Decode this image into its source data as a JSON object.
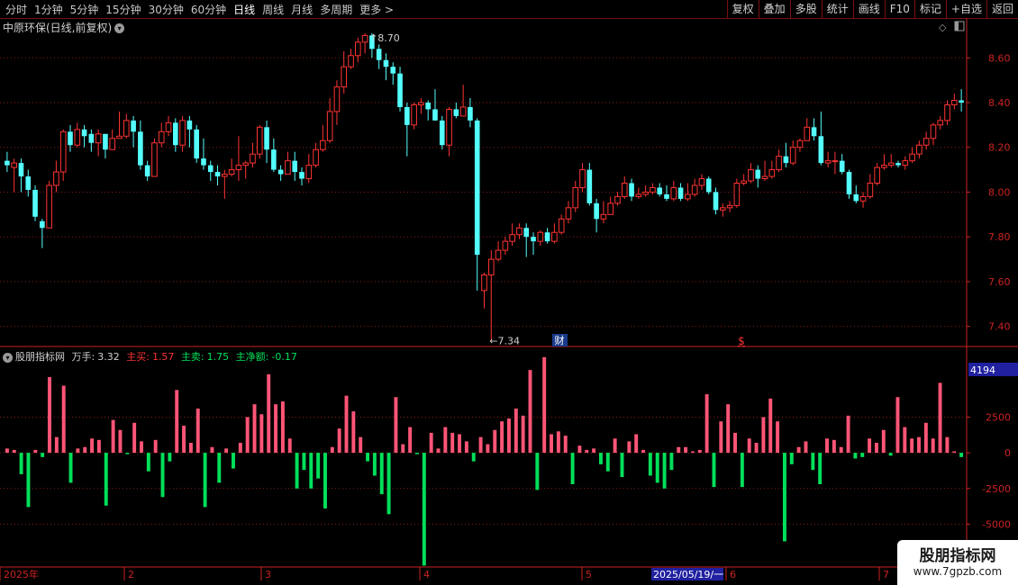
{
  "toolbar": {
    "periods": [
      "分时",
      "1分钟",
      "5分钟",
      "15分钟",
      "30分钟",
      "60分钟",
      "日线",
      "周线",
      "月线",
      "多周期",
      "更多 >"
    ],
    "active_period": "日线",
    "right_buttons": [
      "复权",
      "叠加",
      "多股",
      "统计",
      "画线",
      "F10",
      "标记",
      "+自选",
      "返回"
    ]
  },
  "main_panel": {
    "title": "中原环保(日线,前复权)",
    "high_label": "8.70",
    "low_label": "7.34",
    "marker_cai": "财",
    "marker_dollar": "$",
    "y_ticks": [
      "8.60",
      "8.40",
      "8.20",
      "8.00",
      "7.80",
      "7.60",
      "7.40"
    ]
  },
  "sub_panel": {
    "name": "股朋指标网",
    "wan_label": "万手:",
    "wan_value": "3.32",
    "buy_label": "主买:",
    "buy_value": "1.57",
    "sell_label": "主卖:",
    "sell_value": "1.75",
    "net_label": "主净额:",
    "net_value": "-0.17",
    "y_ticks": [
      "2500",
      "0",
      "-2500",
      "-5000"
    ],
    "current_value": "4194"
  },
  "x_axis": {
    "labels": [
      "2025年",
      "2",
      "3",
      "4",
      "5",
      "6",
      "7"
    ],
    "cursor_date": "2025/05/19/一"
  },
  "watermark": {
    "line1": "股朋指标网",
    "line2": "www.7gpzb.com"
  },
  "colors": {
    "up": "#ff3333",
    "down": "#54ffff",
    "vol_up": "#ff5577",
    "vol_down": "#00e05a",
    "grid": "#8b1a1a",
    "axis": "#cc2222"
  },
  "chart_data": {
    "type": "candlestick",
    "candles": [
      [
        8.14,
        8.12,
        8.18,
        8.09
      ],
      [
        8.11,
        8.13,
        8.15,
        8.0
      ],
      [
        8.13,
        8.07,
        8.15,
        8.0
      ],
      [
        8.07,
        8.01,
        8.1,
        7.98
      ],
      [
        8.01,
        7.89,
        8.03,
        7.87
      ],
      [
        7.87,
        7.84,
        7.88,
        7.75
      ],
      [
        7.84,
        8.03,
        8.05,
        7.84
      ],
      [
        8.03,
        8.09,
        8.14,
        8.0
      ],
      [
        8.09,
        8.27,
        8.28,
        8.05
      ],
      [
        8.27,
        8.21,
        8.3,
        8.18
      ],
      [
        8.21,
        8.28,
        8.31,
        8.2
      ],
      [
        8.28,
        8.25,
        8.3,
        8.2
      ],
      [
        8.26,
        8.22,
        8.28,
        8.18
      ],
      [
        8.22,
        8.26,
        8.28,
        8.16
      ],
      [
        8.26,
        8.19,
        8.26,
        8.15
      ],
      [
        8.19,
        8.24,
        8.28,
        8.2
      ],
      [
        8.24,
        8.25,
        8.36,
        8.24
      ],
      [
        8.25,
        8.32,
        8.35,
        8.24
      ],
      [
        8.32,
        8.27,
        8.34,
        8.2
      ],
      [
        8.27,
        8.12,
        8.32,
        8.1
      ],
      [
        8.12,
        8.07,
        8.14,
        8.05
      ],
      [
        8.07,
        8.22,
        8.24,
        8.07
      ],
      [
        8.22,
        8.27,
        8.31,
        8.2
      ],
      [
        8.27,
        8.31,
        8.34,
        8.25
      ],
      [
        8.31,
        8.21,
        8.33,
        8.18
      ],
      [
        8.21,
        8.32,
        8.34,
        8.18
      ],
      [
        8.32,
        8.28,
        8.34,
        8.2
      ],
      [
        8.28,
        8.15,
        8.3,
        8.13
      ],
      [
        8.15,
        8.12,
        8.24,
        8.1
      ],
      [
        8.12,
        8.09,
        8.14,
        8.05
      ],
      [
        8.09,
        8.07,
        8.12,
        8.03
      ],
      [
        8.07,
        8.08,
        8.1,
        7.97
      ],
      [
        8.08,
        8.1,
        8.15,
        8.07
      ],
      [
        8.1,
        8.12,
        8.25,
        8.05
      ],
      [
        8.12,
        8.13,
        8.14,
        8.06
      ],
      [
        8.13,
        8.17,
        8.22,
        8.11
      ],
      [
        8.17,
        8.29,
        8.3,
        8.15
      ],
      [
        8.29,
        8.19,
        8.32,
        8.13
      ],
      [
        8.19,
        8.1,
        8.24,
        8.09
      ],
      [
        8.1,
        8.08,
        8.12,
        8.05
      ],
      [
        8.08,
        8.14,
        8.18,
        8.08
      ],
      [
        8.14,
        8.09,
        8.18,
        8.05
      ],
      [
        8.09,
        8.06,
        8.11,
        8.03
      ],
      [
        8.06,
        8.12,
        8.17,
        8.04
      ],
      [
        8.12,
        8.19,
        8.22,
        8.11
      ],
      [
        8.19,
        8.23,
        8.3,
        8.18
      ],
      [
        8.23,
        8.36,
        8.42,
        8.22
      ],
      [
        8.36,
        8.47,
        8.5,
        8.3
      ],
      [
        8.47,
        8.56,
        8.63,
        8.44
      ],
      [
        8.56,
        8.61,
        8.64,
        8.55
      ],
      [
        8.61,
        8.67,
        8.69,
        8.58
      ],
      [
        8.67,
        8.7,
        8.71,
        8.62
      ],
      [
        8.7,
        8.64,
        8.71,
        8.6
      ],
      [
        8.64,
        8.59,
        8.66,
        8.55
      ],
      [
        8.59,
        8.56,
        8.62,
        8.5
      ],
      [
        8.56,
        8.53,
        8.58,
        8.48
      ],
      [
        8.53,
        8.38,
        8.56,
        8.36
      ],
      [
        8.38,
        8.3,
        8.4,
        8.16
      ],
      [
        8.3,
        8.39,
        8.4,
        8.28
      ],
      [
        8.39,
        8.4,
        8.42,
        8.35
      ],
      [
        8.4,
        8.37,
        8.41,
        8.32
      ],
      [
        8.37,
        8.32,
        8.46,
        8.32
      ],
      [
        8.32,
        8.21,
        8.34,
        8.19
      ],
      [
        8.21,
        8.37,
        8.38,
        8.16
      ],
      [
        8.37,
        8.34,
        8.4,
        8.33
      ],
      [
        8.34,
        8.38,
        8.48,
        8.34
      ],
      [
        8.38,
        8.32,
        8.42,
        8.29
      ],
      [
        8.32,
        7.72,
        8.33,
        7.56
      ],
      [
        7.56,
        7.63,
        7.64,
        7.48
      ],
      [
        7.63,
        7.7,
        7.74,
        7.34
      ],
      [
        7.7,
        7.74,
        7.78,
        7.69
      ],
      [
        7.74,
        7.78,
        7.8,
        7.72
      ],
      [
        7.78,
        7.81,
        7.86,
        7.76
      ],
      [
        7.81,
        7.84,
        7.86,
        7.79
      ],
      [
        7.84,
        7.8,
        7.86,
        7.71
      ],
      [
        7.8,
        7.78,
        7.82,
        7.72
      ],
      [
        7.78,
        7.82,
        7.83,
        7.76
      ],
      [
        7.82,
        7.78,
        7.84,
        7.77
      ],
      [
        7.78,
        7.82,
        7.86,
        7.77
      ],
      [
        7.82,
        7.88,
        7.9,
        7.81
      ],
      [
        7.88,
        7.93,
        7.96,
        7.86
      ],
      [
        7.93,
        8.02,
        8.05,
        7.91
      ],
      [
        8.02,
        8.1,
        8.13,
        8.0
      ],
      [
        8.1,
        7.95,
        8.13,
        7.94
      ],
      [
        7.95,
        7.88,
        7.97,
        7.82
      ],
      [
        7.88,
        7.9,
        7.96,
        7.86
      ],
      [
        7.9,
        7.95,
        7.98,
        7.9
      ],
      [
        7.95,
        7.98,
        8.0,
        7.94
      ],
      [
        7.98,
        8.04,
        8.07,
        7.97
      ],
      [
        8.04,
        7.98,
        8.06,
        7.96
      ],
      [
        7.98,
        7.99,
        8.02,
        7.97
      ],
      [
        7.99,
        8.0,
        8.03,
        7.98
      ],
      [
        8.0,
        8.02,
        8.04,
        7.99
      ],
      [
        8.02,
        7.99,
        8.04,
        7.98
      ],
      [
        7.99,
        7.97,
        8.03,
        7.96
      ],
      [
        7.97,
        8.02,
        8.05,
        7.96
      ],
      [
        8.02,
        7.97,
        8.04,
        7.96
      ],
      [
        7.97,
        7.99,
        8.04,
        7.96
      ],
      [
        7.99,
        8.03,
        8.06,
        7.98
      ],
      [
        8.03,
        8.06,
        8.08,
        8.01
      ],
      [
        8.06,
        8.0,
        8.07,
        7.99
      ],
      [
        8.0,
        7.92,
        8.02,
        7.9
      ],
      [
        7.92,
        7.93,
        7.95,
        7.89
      ],
      [
        7.93,
        7.94,
        7.96,
        7.91
      ],
      [
        7.94,
        8.04,
        8.06,
        7.93
      ],
      [
        8.04,
        8.05,
        8.08,
        8.03
      ],
      [
        8.05,
        8.1,
        8.13,
        8.04
      ],
      [
        8.1,
        8.06,
        8.12,
        8.02
      ],
      [
        8.06,
        8.07,
        8.14,
        8.05
      ],
      [
        8.07,
        8.1,
        8.14,
        8.06
      ],
      [
        8.1,
        8.16,
        8.19,
        8.09
      ],
      [
        8.16,
        8.13,
        8.22,
        8.11
      ],
      [
        8.13,
        8.2,
        8.23,
        8.12
      ],
      [
        8.2,
        8.23,
        8.24,
        8.18
      ],
      [
        8.23,
        8.29,
        8.33,
        8.23
      ],
      [
        8.29,
        8.25,
        8.33,
        8.23
      ],
      [
        8.25,
        8.13,
        8.36,
        8.12
      ],
      [
        8.13,
        8.14,
        8.18,
        8.11
      ],
      [
        8.14,
        8.14,
        8.18,
        8.08
      ],
      [
        8.14,
        8.09,
        8.17,
        8.08
      ],
      [
        8.09,
        7.99,
        8.1,
        7.97
      ],
      [
        7.99,
        7.96,
        8.03,
        7.95
      ],
      [
        7.96,
        7.98,
        8.0,
        7.93
      ],
      [
        7.98,
        8.04,
        8.08,
        7.97
      ],
      [
        8.04,
        8.11,
        8.13,
        8.03
      ],
      [
        8.11,
        8.12,
        8.17,
        8.1
      ],
      [
        8.12,
        8.13,
        8.17,
        8.11
      ],
      [
        8.13,
        8.12,
        8.14,
        8.11
      ],
      [
        8.12,
        8.14,
        8.16,
        8.1
      ],
      [
        8.14,
        8.17,
        8.2,
        8.13
      ],
      [
        8.17,
        8.21,
        8.23,
        8.15
      ],
      [
        8.21,
        8.24,
        8.27,
        8.19
      ],
      [
        8.24,
        8.3,
        8.31,
        8.21
      ],
      [
        8.3,
        8.32,
        8.34,
        8.28
      ],
      [
        8.32,
        8.39,
        8.41,
        8.3
      ],
      [
        8.39,
        8.41,
        8.44,
        8.37
      ],
      [
        8.41,
        8.4,
        8.46,
        8.36
      ]
    ],
    "volumes": [
      300,
      200,
      -1500,
      -3800,
      200,
      -300,
      5300,
      1100,
      4700,
      -2100,
      300,
      400,
      1000,
      900,
      -3700,
      2300,
      1600,
      -100,
      2100,
      800,
      -1300,
      900,
      -3100,
      -600,
      4400,
      1900,
      700,
      3100,
      -3800,
      400,
      -2100,
      300,
      -1100,
      700,
      2500,
      3400,
      2700,
      5500,
      3400,
      3600,
      1000,
      -2500,
      -1200,
      -2500,
      -1800,
      -3900,
      400,
      1700,
      4000,
      2900,
      1100,
      -600,
      -1600,
      -2900,
      -4300,
      3900,
      600,
      1800,
      -100,
      -7900,
      1400,
      300,
      1800,
      1400,
      1300,
      800,
      -600,
      1100,
      600,
      1600,
      2200,
      2400,
      3100,
      2600,
      5800,
      -2600,
      6700,
      1300,
      1500,
      1200,
      -2200,
      500,
      200,
      300,
      -800,
      -1300,
      1000,
      -1700,
      800,
      1300,
      200,
      -1600,
      -2100,
      -2500,
      -1200,
      400,
      400,
      100,
      200,
      4100,
      -2400,
      2200,
      3400,
      1400,
      -2400,
      1000,
      700,
      2500,
      3800,
      2200,
      -6200,
      -800,
      400,
      800,
      -1200,
      -2200,
      1000,
      900,
      400,
      2600,
      -400,
      -300,
      1000,
      700,
      1600,
      -200,
      3900,
      1800,
      1000,
      1100,
      2100,
      1000,
      4900,
      1100,
      100,
      -300
    ]
  }
}
